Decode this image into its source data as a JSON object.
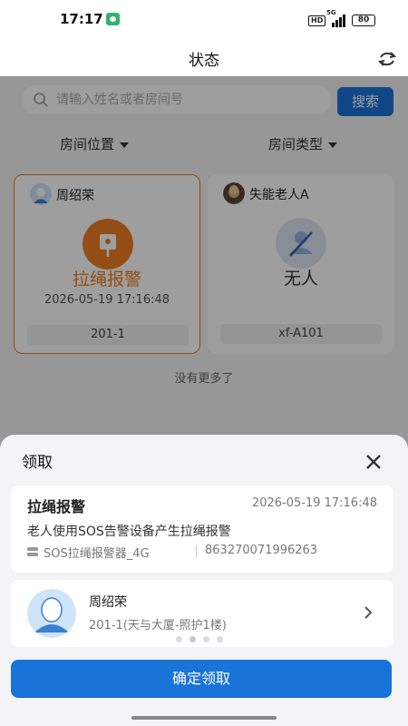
{
  "status_bar": {
    "time": "17:17",
    "network_badge": "HD",
    "network_type": "5G",
    "battery": "80"
  },
  "header": {
    "title": "状态",
    "refresh_icon": "refresh-icon"
  },
  "search": {
    "placeholder": "请输入姓名或者房间号",
    "button_label": "搜索"
  },
  "filters": [
    {
      "label": "房间位置"
    },
    {
      "label": "房间类型"
    }
  ],
  "rooms": [
    {
      "name": "周绍荣",
      "status": "拉绳报警",
      "time": "2026-05-19 17:16:48",
      "room": "201-1",
      "status_color": "#ef7d22",
      "active": true,
      "icon": "alarm-icon"
    },
    {
      "name": "失能老人A",
      "status": "无人",
      "time": "",
      "room": "xf-A101",
      "status_color": "#333333",
      "active": false,
      "icon": "no-person-icon"
    }
  ],
  "no_more_text": "没有更多了",
  "sheet": {
    "title": "领取",
    "alarm": {
      "type": "拉绳报警",
      "time": "2026-05-19 17:16:48",
      "description": "老人使用SOS告警设备产生拉绳报警",
      "device_name": "SOS拉绳报警器_4G",
      "device_id": "863270071996263"
    },
    "person": {
      "name": "周绍荣",
      "room": "201-1(天与大厦-照护1楼)"
    },
    "confirm_label": "确定领取"
  },
  "colors": {
    "accent": "#1a73d9",
    "alarm": "#ef7d22",
    "no_person": "#8fb2e6"
  }
}
